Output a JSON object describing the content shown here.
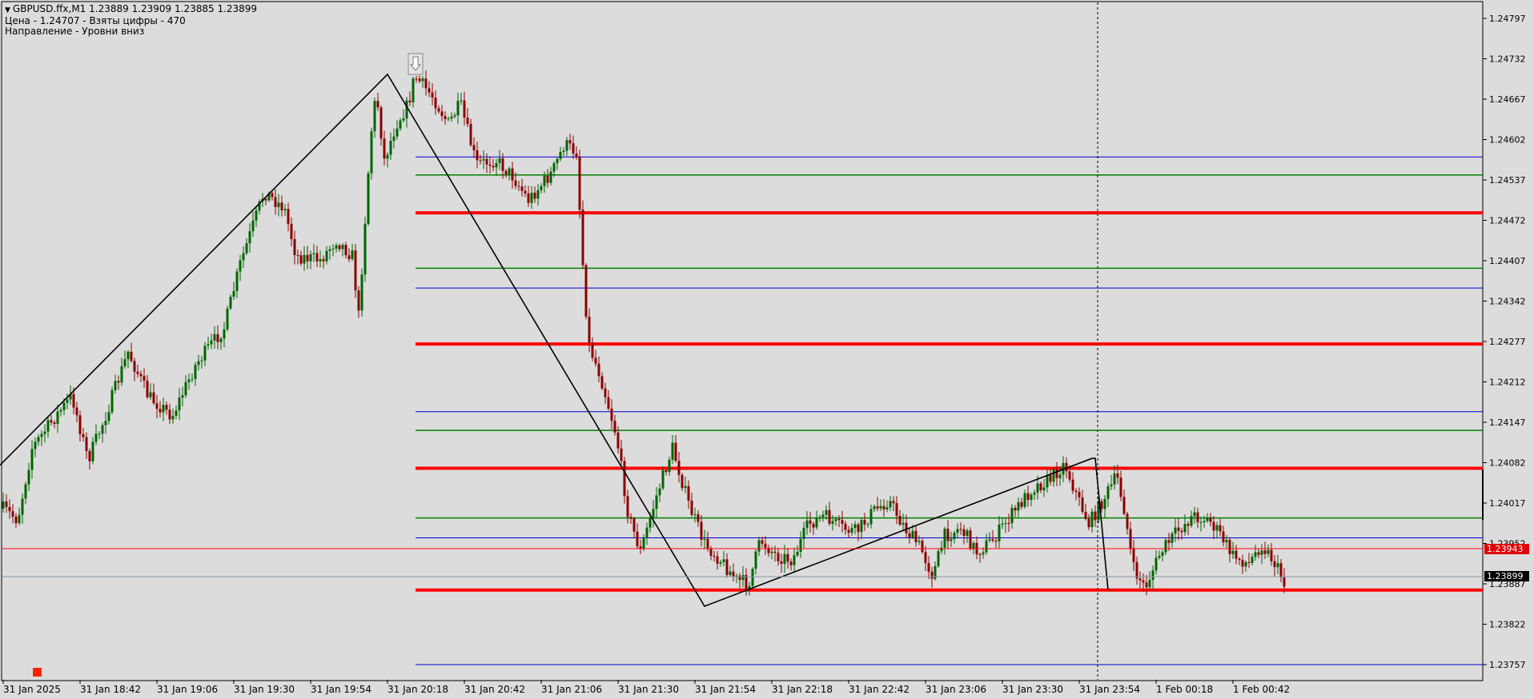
{
  "header": {
    "symbol_line": "GBPUSD.ffx,M1  1.23889 1.23909 1.23885 1.23899",
    "info_line": "Цена - 1.24707 - Взяты цифры - 470",
    "direction_line": "Направление - Уровни вниз"
  },
  "price_axis": {
    "ticks": [
      "1.24797",
      "1.24732",
      "1.24667",
      "1.24602",
      "1.24537",
      "1.24472",
      "1.24407",
      "1.24342",
      "1.24277",
      "1.24212",
      "1.24147",
      "1.24082",
      "1.24017",
      "1.23952",
      "1.23887",
      "1.23822",
      "1.23757"
    ],
    "bid_tag": "1.23943",
    "last_tag": "1.23899"
  },
  "time_axis": {
    "labels": [
      "31 Jan 2025",
      "31 Jan 18:42",
      "31 Jan 19:06",
      "31 Jan 19:30",
      "31 Jan 19:54",
      "31 Jan 20:18",
      "31 Jan 20:42",
      "31 Jan 21:06",
      "31 Jan 21:30",
      "31 Jan 21:54",
      "31 Jan 22:18",
      "31 Jan 22:42",
      "31 Jan 23:06",
      "31 Jan 23:30",
      "31 Jan 23:54",
      "1 Feb 00:18",
      "1 Feb 00:42"
    ]
  },
  "colors": {
    "background": "#dcdcdc",
    "bull_candle": "#006400",
    "bear_candle": "#8b0000",
    "level_red": "#ff0000",
    "level_green": "#008000",
    "level_blue": "#0000cd"
  },
  "levels": [
    {
      "color": "blue",
      "price": 1.24574
    },
    {
      "color": "green",
      "price": 1.24545
    },
    {
      "color": "red",
      "price": 1.24484
    },
    {
      "color": "green",
      "price": 1.24395
    },
    {
      "color": "blue",
      "price": 1.24363
    },
    {
      "color": "red",
      "price": 1.24273
    },
    {
      "color": "blue",
      "price": 1.24164
    },
    {
      "color": "green",
      "price": 1.24134
    },
    {
      "color": "red",
      "price": 1.24073
    },
    {
      "color": "green",
      "price": 1.23993
    },
    {
      "color": "blue",
      "price": 1.23961
    },
    {
      "color": "red",
      "price": 1.23877
    },
    {
      "color": "blue",
      "price": 1.23757
    }
  ],
  "zigzag_points": [
    {
      "time": "31 Jan 18:17",
      "price": 1.24078
    },
    {
      "time": "31 Jan 20:18",
      "price": 1.24707
    },
    {
      "time": "31 Jan 21:57",
      "price": 1.23851
    },
    {
      "time": "31 Jan 23:58",
      "price": 1.24089
    },
    {
      "time": "31 Jan 23:59",
      "price": 1.24089
    },
    {
      "time": "1 Feb 00:03",
      "price": 1.23877
    }
  ],
  "markers": {
    "arrow_icon": "down-arrow-icon",
    "marker_icon": "red-square-icon"
  }
}
